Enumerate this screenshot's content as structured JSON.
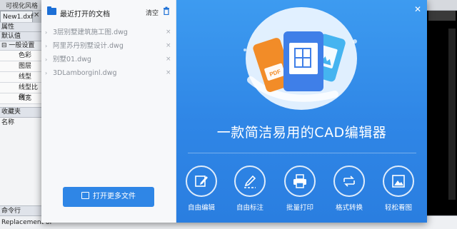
{
  "app": {
    "top_title": "可视化风格",
    "file_tab": "New1.dxf",
    "tab_close": "✕"
  },
  "properties_panel": {
    "header": "属性",
    "sub_header": "默认值",
    "group": "⊟ 一般设置",
    "rows": [
      "色彩",
      "图层",
      "线型",
      "线型比例",
      "线宽"
    ]
  },
  "favorites_panel": {
    "header": "收藏夹",
    "name_label": "名称"
  },
  "command_line": {
    "header": "命令行",
    "status_text": "Replacement of"
  },
  "dialog": {
    "recent": {
      "title": "最近打开的文档",
      "clear_label": "清空",
      "files": [
        "3层别墅建筑施工图.dwg",
        "阿里苏丹别墅设计.dwg",
        "别墅01.dwg",
        "3DLamborginl.dwg"
      ],
      "open_more_label": "打开更多文件"
    },
    "main": {
      "close_label": "✕",
      "slogan": "一款简洁易用的CAD编辑器",
      "file_badges": [
        "PDF",
        "DWG",
        "IMG"
      ],
      "actions": [
        {
          "icon": "edit-icon",
          "label": "自由编辑"
        },
        {
          "icon": "annotate-icon",
          "label": "自由标注"
        },
        {
          "icon": "print-icon",
          "label": "批量打印"
        },
        {
          "icon": "convert-icon",
          "label": "格式转换"
        },
        {
          "icon": "image-view-icon",
          "label": "轻松看图"
        }
      ]
    },
    "colors": {
      "accent": "#2f86e6",
      "pdf_badge": "#f28c28",
      "dwg_badge": "#3f7fe8",
      "img_badge": "#45b4f0"
    }
  }
}
